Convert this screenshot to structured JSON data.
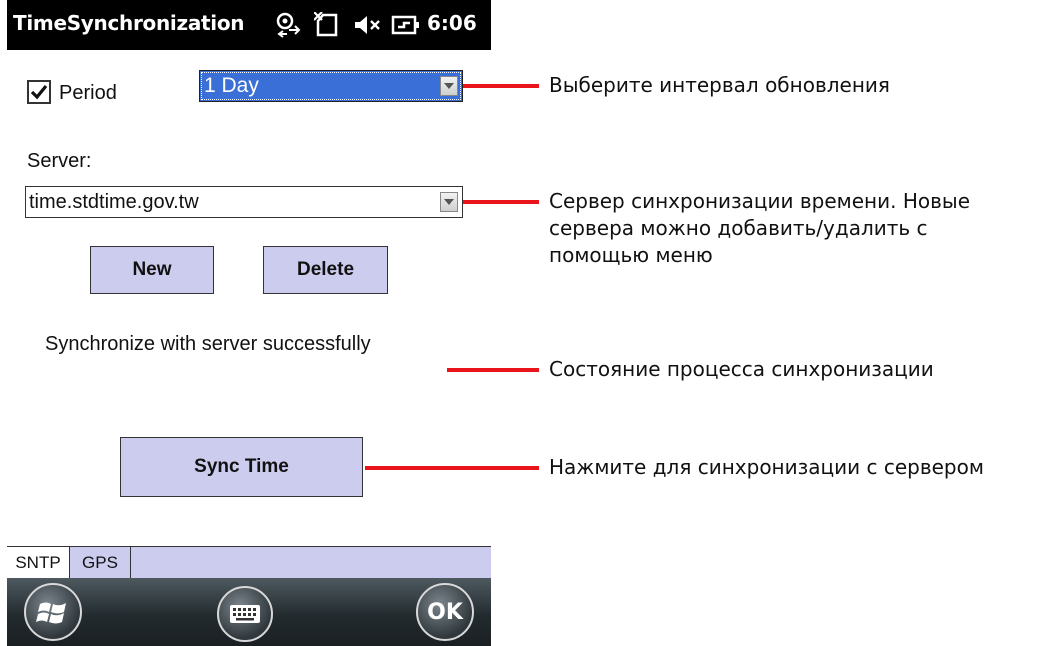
{
  "titlebar": {
    "app_title": "TimeSynchronization",
    "clock": "6:06",
    "icons": [
      "connectivity-icon",
      "no-sim-icon",
      "volume-muted-icon",
      "battery-charging-icon"
    ]
  },
  "period": {
    "checked": true,
    "label": "Period",
    "interval_value": "1 Day"
  },
  "server": {
    "label": "Server:",
    "value": "time.stdtime.gov.tw"
  },
  "buttons": {
    "new": "New",
    "delete": "Delete",
    "sync": "Sync Time",
    "ok": "OK"
  },
  "status": {
    "text": "Synchronize with server successfully"
  },
  "tabs": [
    {
      "label": "SNTP",
      "active": true
    },
    {
      "label": "GPS",
      "active": false
    }
  ],
  "callouts": {
    "interval": "Выберите интервал обновления",
    "server_line1": "Сервер синхронизации времени. Новые",
    "server_line2": "сервера можно добавить/удалить с",
    "server_line3": "помощью меню",
    "status": "Состояние процесса синхронизации",
    "sync": "Нажмите для синхронизации с сервером"
  },
  "colors": {
    "callout_line": "#e8141a",
    "button_fill": "#ccccee",
    "selected_dropdown": "#3a6fd8"
  }
}
